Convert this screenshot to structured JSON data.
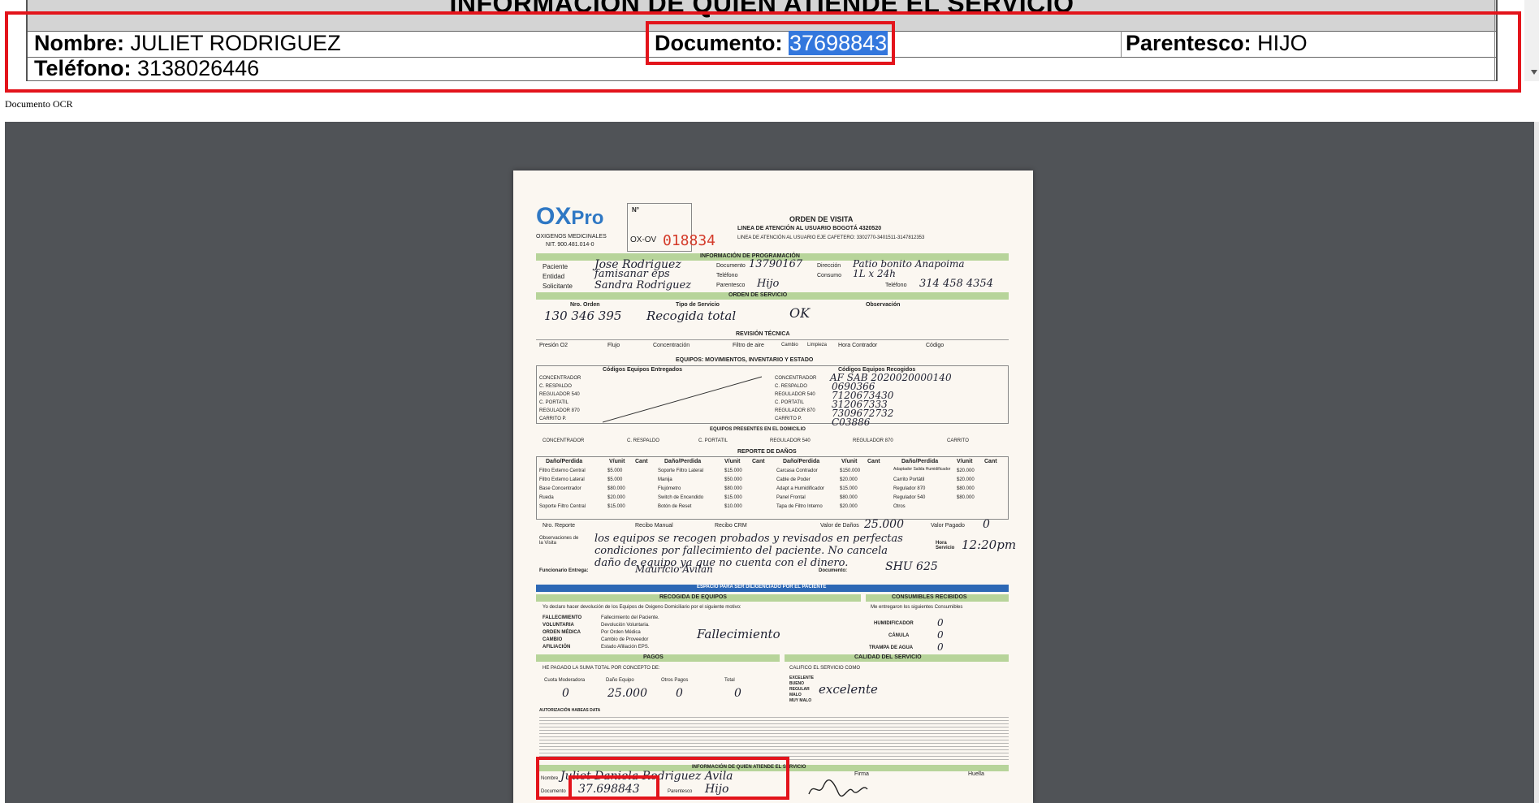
{
  "info_panel": {
    "title": "INFORMACIÓN DE QUIEN ATIENDE EL SERVICIO",
    "nombre_label": "Nombre:",
    "nombre_value": "JULIET RODRIGUEZ",
    "documento_label": "Documento:",
    "documento_value": "37698843",
    "parentesco_label": "Parentesco:",
    "parentesco_value": "HIJO",
    "telefono_label": "Teléfono:",
    "telefono_value": "3138026446"
  },
  "ocr_label": "Documento OCR",
  "document": {
    "logo_text": "Pro",
    "company": "OXIGENOS MEDICINALES",
    "nit": "NIT. 900.481.014-0",
    "no_label": "N°",
    "serial_prefix": "OX-OV",
    "serial": "018834",
    "header_title": "ORDEN DE VISITA",
    "header_line1": "LINEA DE ATENCIÓN AL USUARIO BOGOTÁ 4320520",
    "header_line2": "LINEA DE ATENCIÓN AL USUARIO EJE CAFETERO: 3302770-3401511-3147812353",
    "programacion_title": "INFORMACIÓN DE PROGRAMACIÓN",
    "paciente_label": "Paciente",
    "paciente_value": "Jose Rodriguez",
    "entidad_label": "Entidad",
    "entidad_value": "famisanar eps",
    "solicitante_label": "Solicitante",
    "solicitante_value": "Sandra Rodriguez",
    "documento_label": "Documento",
    "documento_value": "13790167",
    "telefono_label": "Teléfono",
    "parentesco_label": "Parentesco",
    "parentesco_value": "Hijo",
    "direccion_label": "Dirección",
    "direccion_value": "Patio bonito Anapoima",
    "consumo_label": "Consumo",
    "consumo_value": "1L x 24h",
    "telefono2_label": "Teléfono",
    "telefono2_value": "314 458 4354",
    "orden_title": "ORDEN DE SERVICIO",
    "nro_orden_label": "Nro. Orden",
    "nro_orden_value": "130 346 395",
    "tipo_label": "Tipo de Servicio",
    "tipo_value": "Recogida total",
    "ok_value": "OK",
    "observacion_label": "Observación",
    "revision_title": "REVISIÓN TÉCNICA",
    "revision_fields": [
      "Presión O2",
      "Flujo",
      "Concentración",
      "Filtro de aire",
      "Cambio",
      "Limpieza",
      "Hora Contrador",
      "Código"
    ],
    "equipos_title": "EQUIPOS: MOVIMIENTOS, INVENTARIO Y ESTADO",
    "entregados_label": "Códigos Equipos Entregados",
    "recogidos_label": "Códigos Equipos Recogidos",
    "equipos_rows": [
      "CONCENTRADOR",
      "C. RESPALDO",
      "REGULADOR 540",
      "C. PORTATIL",
      "REGULADOR 870",
      "CARRITO P."
    ],
    "recogidos_values": [
      "AF SAB 2020020000140",
      "0690366",
      "7120673430",
      "312067333",
      "7309672732",
      "C03886"
    ],
    "presentes_title": "EQUIPOS PRESENTES EN EL DOMICILIO",
    "presentes_items": [
      "CONCENTRADOR",
      "C. RESPALDO",
      "C. PORTATIL",
      "REGULADOR 540",
      "REGULADOR 870",
      "CARRITO"
    ],
    "danos_title": "REPORTE DE DAÑOS",
    "danos_headers": [
      "Daño/Perdida",
      "V/unit",
      "Cant"
    ],
    "danos_col1": [
      [
        "Filtro Externo Central",
        "$5.000"
      ],
      [
        "Filtro Externo Lateral",
        "$5.000"
      ],
      [
        "Base Concentrador",
        "$80.000"
      ],
      [
        "Rueda",
        "$20.000"
      ],
      [
        "Soporte Filtro Central",
        "$15.000"
      ]
    ],
    "danos_col2": [
      [
        "Soporte Filtro Lateral",
        "$15.000"
      ],
      [
        "Manija",
        "$50.000"
      ],
      [
        "Flujómetro",
        "$80.000"
      ],
      [
        "Switch de Encendido",
        "$15.000"
      ],
      [
        "Botón de Reset",
        "$10.000"
      ]
    ],
    "danos_col3": [
      [
        "Carcasa Contrador",
        "$150.000"
      ],
      [
        "Cable de Poder",
        "$20.000"
      ],
      [
        "Adapt a Humidificador",
        "$15.000"
      ],
      [
        "Panel Frontal",
        "$80.000"
      ],
      [
        "Tapa de Filtro Interno",
        "$20.000"
      ]
    ],
    "danos_col4": [
      [
        "Adaptador Salida Humidificador",
        "$20.000"
      ],
      [
        "Carrito Portátil",
        "$20.000"
      ],
      [
        "Regulador 870",
        "$80.000"
      ],
      [
        "Regulador 540",
        "$80.000"
      ],
      [
        "Otros",
        ""
      ]
    ],
    "nro_reporte_label": "Nro. Reporte",
    "recibo_manual_label": "Recibo Manual",
    "recibo_crm_label": "Recibo CRM",
    "valor_danos_label": "Valor de Daños",
    "valor_danos_value": "25.000",
    "valor_pagado_label": "Valor Pagado",
    "valor_pagado_value": "0",
    "observaciones_label": "Observaciones de la Visita",
    "observaciones_value": "los equipos se recogen probados y revisados en perfectas condiciones por fallecimiento del paciente. No cancela daño de equipo ya que no cuenta con el dinero.",
    "hora_label": "Hora Servicio",
    "hora_value": "12:20pm",
    "funcionario_label": "Funcionario Entrega:",
    "funcionario_value": "Mauricio Avilan",
    "documento_func_label": "Documento:",
    "documento_func_value": "SHU 625",
    "paciente_section_title": "ESPACIO PARA SER DILIGENCIADO POR EL PACIENTE",
    "recogida_title": "RECOGIDA DE EQUIPOS",
    "consumibles_title": "CONSUMIBLES RECIBIDOS",
    "recogida_text": "Yo declaro hacer devolución de los Equipos de Oxigeno Domiciliario por el siguiente motivo:",
    "recogida_options": [
      [
        "FALLECIMIENTO",
        "Fallecimiento del Paciente."
      ],
      [
        "VOLUNTARIA",
        "Devolución Voluntaria."
      ],
      [
        "ORDEN MÉDICA",
        "Por Orden Médica"
      ],
      [
        "CAMBIO",
        "Cambio de Proveedor"
      ],
      [
        "AFILIACIÓN",
        "Estado Afiliación EPS."
      ]
    ],
    "motivo_value": "Fallecimiento",
    "consumibles_text": "Me entregaron los siguientes Consumibles",
    "consumibles_items": [
      "HUMIDIFICADOR",
      "CÁNULA",
      "TRAMPA DE AGUA"
    ],
    "consumibles_values": [
      "0",
      "0",
      "0"
    ],
    "pagos_title": "PAGOS",
    "calidad_title": "CALIDAD DEL SERVICIO",
    "pagado_text": "HE PAGADO LA SUMA TOTAL POR CONCEPTO DE:",
    "pagos_items": [
      "Cuota Moderadora",
      "Daño Equipo",
      "Otros Pagos",
      "Total"
    ],
    "pagos_values": [
      "0",
      "25.000",
      "0",
      "0"
    ],
    "calidad_text": "CALIFICO EL SERVICIO COMO",
    "calidad_options": [
      "EXCELENTE",
      "BUENO",
      "REGULAR",
      "MALO",
      "MUY MALO"
    ],
    "calidad_value": "excelente",
    "habeas_title": "AUTORIZACIÓN HABEAS DATA",
    "atiende_title": "INFORMACIÓN DE QUIEN ATIENDE EL SERVICIO",
    "nombre_hand": "Juliet Daniela Rodriguez Avila",
    "doc_hand": "37.698843",
    "parentesco_hand": "Hijo",
    "firma_label": "Firma",
    "huella_label": "Huella",
    "nombre_small": "Nombre",
    "documento_small": "Documento",
    "parentesco_small": "Parentesco"
  },
  "colors": {
    "highlight_red": "#e3141b",
    "selection_blue": "#3377dd",
    "viewer_bg": "#505357",
    "form_green": "#b7d49a",
    "form_blue": "#2d68b5"
  }
}
